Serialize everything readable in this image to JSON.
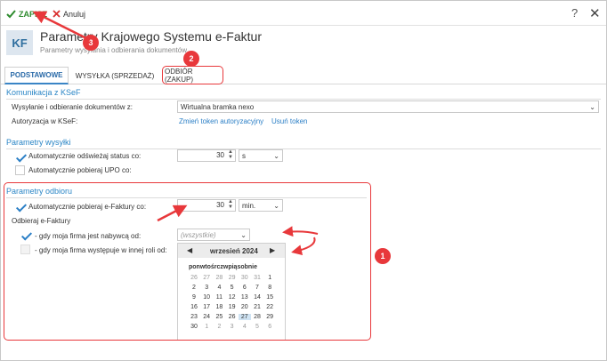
{
  "toolbar": {
    "save": "ZAPISZ",
    "cancel": "Anuluj",
    "help": "?",
    "close": "✕"
  },
  "header": {
    "logo": "KF",
    "title": "Parametry Krajowego Systemu e-Faktur",
    "subtitle": "Parametry wysyłania i odbierania dokumentów"
  },
  "tabs": [
    {
      "label": "PODSTAWOWE",
      "active": true
    },
    {
      "label": "WYSYŁKA (SPRZEDAŻ)",
      "active": false
    },
    {
      "label": "ODBIÓR (ZAKUP)",
      "active": false
    }
  ],
  "ksef": {
    "section": "Komunikacja z KSeF",
    "send_label": "Wysyłanie i odbieranie dokumentów z:",
    "send_value": "Wirtualna bramka nexo",
    "auth_label": "Autoryzacja w KSeF:",
    "auth_change": "Zmień token autoryzacyjny",
    "auth_remove": "Usuń token"
  },
  "send_params": {
    "section": "Parametry wysyłki",
    "refresh_label": "Automatycznie odświeżaj status co:",
    "refresh_value": "30",
    "refresh_unit": "s",
    "upo_label": "Automatycznie pobieraj UPO co:"
  },
  "receive_params": {
    "section": "Parametry odbioru",
    "fetch_label": "Automatycznie pobieraj e-Faktury co:",
    "fetch_value": "30",
    "fetch_unit": "min.",
    "receive_label": "Odbieraj e-Faktury",
    "buyer_label": "- gdy moja firma jest nabywcą od:",
    "buyer_value": "(wszystkie)",
    "other_label": "- gdy moja firma występuje w innej roli od:"
  },
  "calendar": {
    "month": "wrzesień 2024",
    "prev": "◀",
    "next": "▶",
    "weekdays": "ponwtośrczwpiąsobnie",
    "weeks": [
      [
        "26",
        "27",
        "28",
        "29",
        "30",
        "31",
        "1"
      ],
      [
        "2",
        "3",
        "4",
        "5",
        "6",
        "7",
        "8"
      ],
      [
        "9",
        "10",
        "11",
        "12",
        "13",
        "14",
        "15"
      ],
      [
        "16",
        "17",
        "18",
        "19",
        "20",
        "21",
        "22"
      ],
      [
        "23",
        "24",
        "25",
        "26",
        "27",
        "28",
        "29"
      ],
      [
        "30",
        "1",
        "2",
        "3",
        "4",
        "5",
        "6"
      ]
    ],
    "selected": "27"
  },
  "badges": {
    "b1": "1",
    "b2": "2",
    "b3": "3"
  },
  "colors": {
    "accent": "#2b7fc6",
    "save_green": "#2e8b2e",
    "annotation_red": "#e8383b"
  }
}
